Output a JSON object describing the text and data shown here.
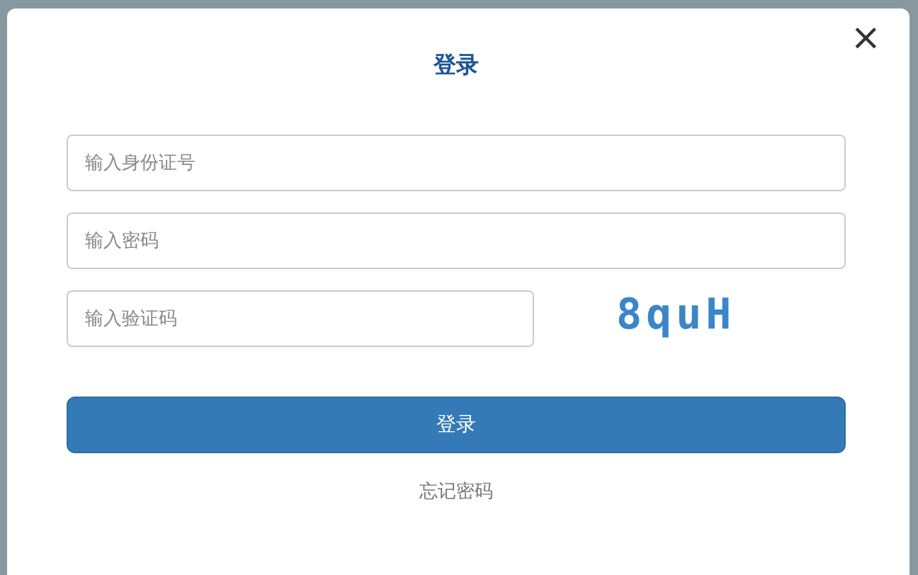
{
  "dialog": {
    "title": "登录",
    "close": "×"
  },
  "fields": [
    {
      "placeholder": "输入身份证号"
    },
    {
      "placeholder": "输入密码"
    },
    {
      "placeholder": "输入验证码"
    }
  ],
  "captcha": {
    "text": "8quH"
  },
  "submit": "登录",
  "forgot_link": "忘记密码"
}
